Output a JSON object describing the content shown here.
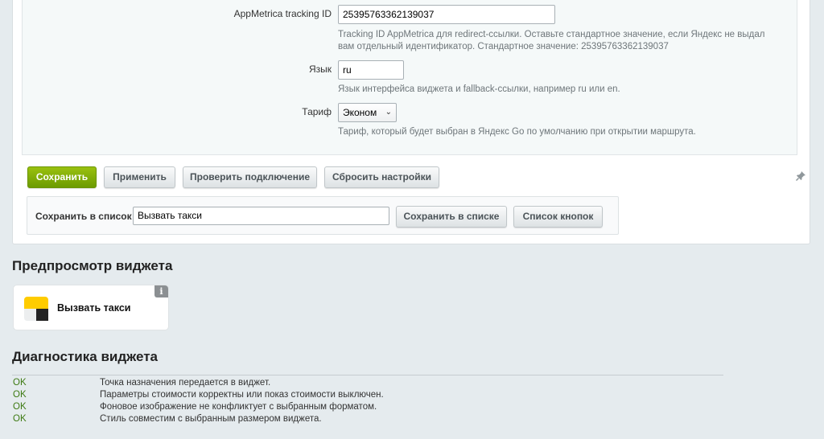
{
  "settings": {
    "appmetrica_label": "AppMetrica tracking ID",
    "appmetrica_value": "25395763362139037",
    "appmetrica_hint_line1": "Tracking ID AppMetrica для redirect-ссылки. Оставьте стандартное значение, если Яндекс не выдал",
    "appmetrica_hint_line2": "вам отдельный идентификатор. Стандартное значение: 25395763362139037",
    "language_label": "Язык",
    "language_value": "ru",
    "language_hint": "Язык интерфейса виджета и fallback-ссылки, например ru или en.",
    "tariff_label": "Тариф",
    "tariff_selected": "Эконом",
    "tariff_hint": "Тариф, который будет выбран в Яндекс Go по умолчанию при открытии маршрута."
  },
  "toolbar": {
    "save": "Сохранить",
    "apply": "Применить",
    "check_connection": "Проверить подключение",
    "reset_settings": "Сбросить настройки"
  },
  "save_to_list": {
    "label": "Сохранить в список",
    "value": "Вызвать такси",
    "save_in_list_button": "Сохранить в списке",
    "button_list_button": "Список кнопок"
  },
  "preview": {
    "title": "Предпросмотр виджета",
    "widget_text": "Вызвать такси",
    "info_badge": "i"
  },
  "diagnostics": {
    "title": "Диагностика виджета",
    "rows": [
      {
        "status": "OK",
        "message": "Точка назначения передается в виджет."
      },
      {
        "status": "OK",
        "message": "Параметры стоимости корректны или показ стоимости выключен."
      },
      {
        "status": "OK",
        "message": "Фоновое изображение не конфликтует с выбранным форматом."
      },
      {
        "status": "OK",
        "message": "Стиль совместим с выбранным размером виджета."
      }
    ]
  },
  "colors": {
    "primary_button": "#7aab04",
    "ok_status": "#3d7a12",
    "taxi_yellow": "#ffcc00",
    "taxi_dark": "#222222"
  },
  "icons": [
    "pin-icon",
    "info-icon",
    "taxi-logo-icon",
    "chevron-down-icon"
  ]
}
